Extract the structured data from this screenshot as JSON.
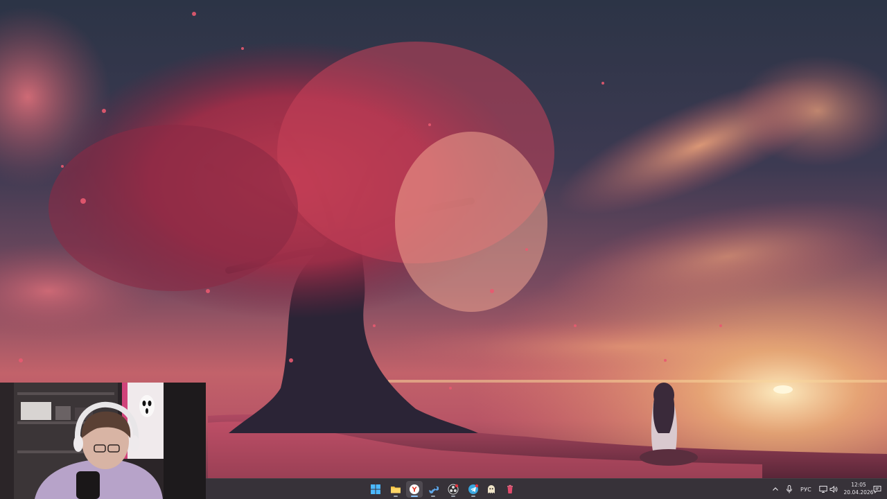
{
  "taskbar": {
    "apps": [
      {
        "name": "start-button",
        "icon": "windows-logo-icon"
      },
      {
        "name": "file-explorer",
        "icon": "folder-icon"
      },
      {
        "name": "yandex-browser",
        "icon": "yandex-browser-icon",
        "active": true
      },
      {
        "name": "steam",
        "icon": "steam-icon"
      },
      {
        "name": "obs-studio",
        "icon": "obs-icon"
      },
      {
        "name": "telegram",
        "icon": "telegram-icon"
      },
      {
        "name": "app-ghost",
        "icon": "ghost-icon"
      },
      {
        "name": "app-trash",
        "icon": "trash-icon"
      }
    ],
    "tray": {
      "language": "РУС",
      "time": "12:05",
      "date": "20.04.2026"
    }
  },
  "colors": {
    "taskbar_bg": "#262128",
    "accent": "#8fc8ff",
    "sky_top": "#2b3345",
    "sunset": "#f7c27a",
    "blossom": "#e0455c"
  }
}
